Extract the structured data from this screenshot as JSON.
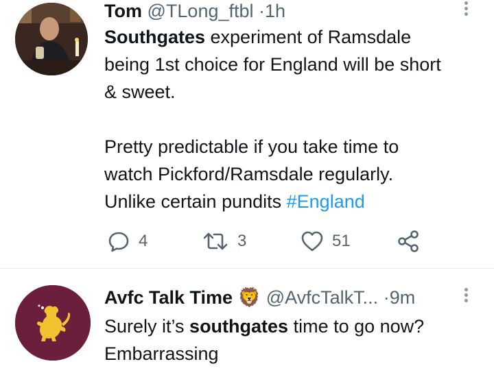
{
  "tweets": [
    {
      "name": "Tom",
      "handle": "@TLong_ftbl",
      "separator": "·",
      "time": "1h",
      "text_lines": [
        {
          "bold": "Southgates",
          "rest": " experiment of Ramsdale"
        },
        {
          "text": "being 1st choice for England will be short"
        },
        {
          "text": "& sweet."
        },
        {
          "text": ""
        },
        {
          "text": "Pretty predictable if you take time to"
        },
        {
          "text": "watch Pickford/Ramsdale regularly."
        },
        {
          "text": "Unlike certain pundits ",
          "hashtag": "#England"
        }
      ],
      "reply_count": "4",
      "retweet_count": "3",
      "like_count": "51"
    },
    {
      "name": "Avfc Talk Time",
      "emoji": "🦁",
      "handle": "@AvfcTalkT...",
      "separator": "·",
      "time": "9m",
      "text_lines": [
        {
          "pre": "Surely it’s ",
          "bold": "southgates",
          "rest": " time to go now?"
        },
        {
          "text": "Embarrassing"
        }
      ]
    }
  ],
  "colors": {
    "text": "#0f1419",
    "secondary": "#536471",
    "link": "#1d9bf0",
    "avatar2_bg": "#6b1f3d",
    "lion_gold": "#f2c230"
  },
  "icons": [
    "reply-icon",
    "retweet-icon",
    "like-icon",
    "share-icon",
    "more-options-icon",
    "lion-emoji-icon"
  ]
}
